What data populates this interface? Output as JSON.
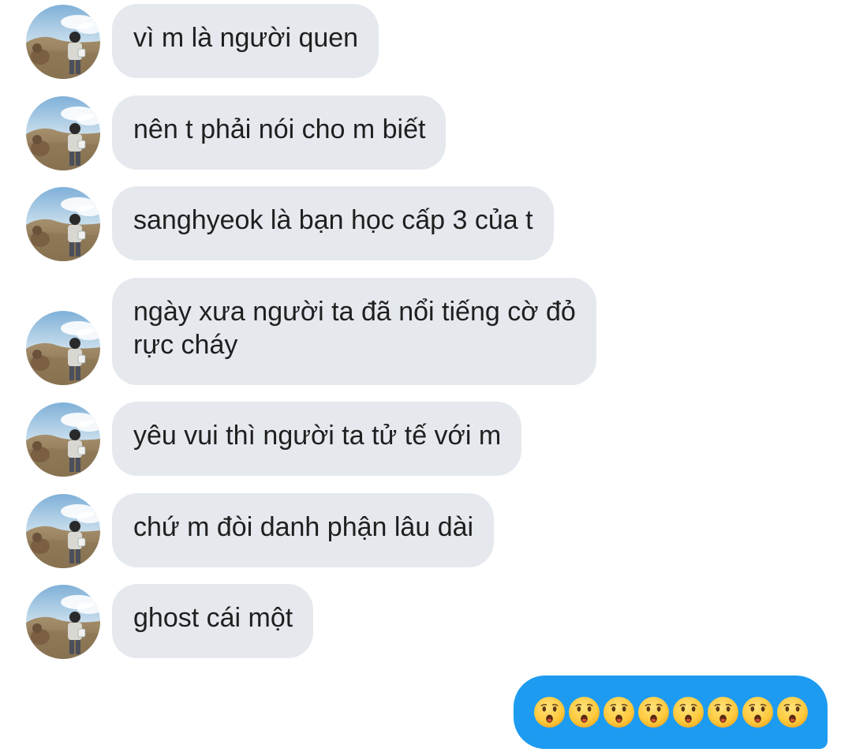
{
  "conversation": {
    "incoming_messages": [
      {
        "text": "vì m là người quen"
      },
      {
        "text": "nên t phải nói cho m biết"
      },
      {
        "text": "sanghyeok là bạn học cấp 3 của t"
      },
      {
        "text_line1": "ngày xưa người ta đã nổi tiếng cờ đỏ",
        "text_line2": "rực cháy"
      },
      {
        "text": "yêu vui thì người ta tử tế với m"
      },
      {
        "text": "chứ m đòi danh phận lâu dài"
      },
      {
        "text": "ghost cái một"
      }
    ],
    "outgoing_message": {
      "emoji": "😦😦😦😦😦😦😦😦",
      "emoji_icon": "frowning-face-with-open-mouth-icon",
      "emoji_count": 8
    },
    "colors": {
      "incoming_bubble": "#e5e9ee",
      "outgoing_bubble": "#1d9bf0",
      "text": "#1f1f1f"
    }
  }
}
